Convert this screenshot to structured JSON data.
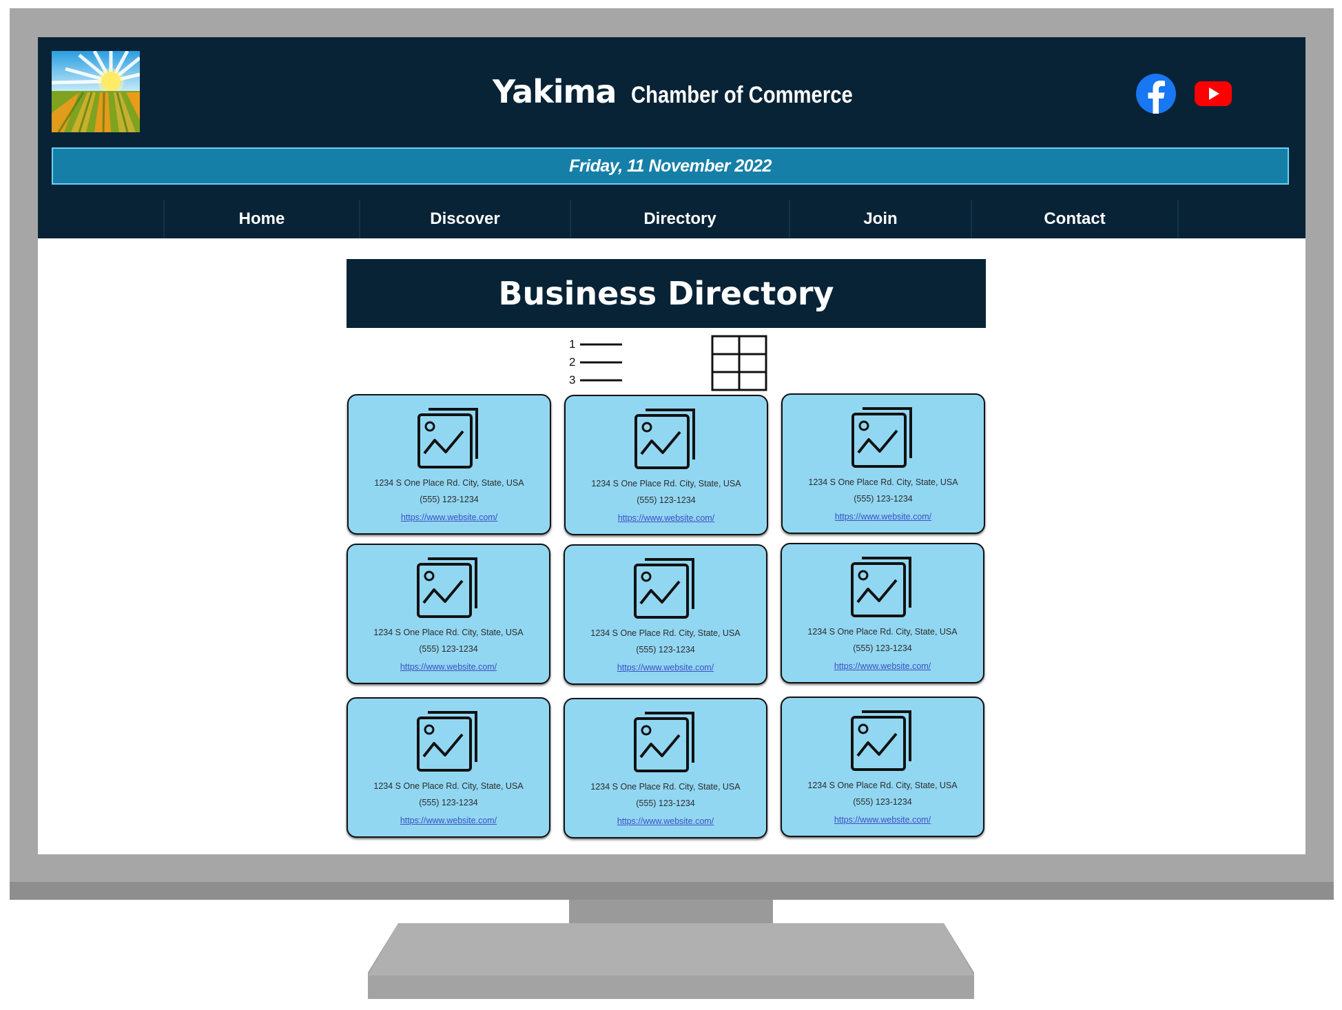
{
  "header": {
    "city": "Yakima",
    "org": "Chamber of Commerce",
    "date": "Friday, 11 November 2022",
    "logo_icon": "sunrise-field-logo",
    "social": [
      {
        "name": "facebook-icon",
        "color": "#1877f2"
      },
      {
        "name": "youtube-icon",
        "color": "#ff0000"
      }
    ]
  },
  "nav": {
    "items": [
      "Home",
      "Discover",
      "Directory",
      "Join",
      "Contact"
    ]
  },
  "main": {
    "title": "Business Directory",
    "view_toggle": {
      "list_numbers": [
        "1",
        "2",
        "3"
      ],
      "list_icon": "numbered-list-icon",
      "grid_icon": "grid-view-icon"
    },
    "businesses": [
      {
        "address": "1234 S One Place Rd. City, State, USA",
        "phone": "(555) 123-1234",
        "url": "https://www.website.com/"
      },
      {
        "address": "1234 S One Place Rd. City, State, USA",
        "phone": "(555) 123-1234",
        "url": "https://www.website.com/"
      },
      {
        "address": "1234 S One Place Rd. City, State, USA",
        "phone": "(555) 123-1234",
        "url": "https://www.website.com/"
      },
      {
        "address": "1234 S One Place Rd. City, State, USA",
        "phone": "(555) 123-1234",
        "url": "https://www.website.com/"
      },
      {
        "address": "1234 S One Place Rd. City, State, USA",
        "phone": "(555) 123-1234",
        "url": "https://www.website.com/"
      },
      {
        "address": "1234 S One Place Rd. City, State, USA",
        "phone": "(555) 123-1234",
        "url": "https://www.website.com/"
      },
      {
        "address": "1234 S One Place Rd. City, State, USA",
        "phone": "(555) 123-1234",
        "url": "https://www.website.com/"
      },
      {
        "address": "1234 S One Place Rd. City, State, USA",
        "phone": "(555) 123-1234",
        "url": "https://www.website.com/"
      },
      {
        "address": "1234 S One Place Rd. City, State, USA",
        "phone": "(555) 123-1234",
        "url": "https://www.website.com/"
      }
    ]
  },
  "colors": {
    "header_bg": "#082336",
    "date_bar": "#167fa8",
    "card_bg": "#92d7f2",
    "link": "#3a4fc4"
  }
}
